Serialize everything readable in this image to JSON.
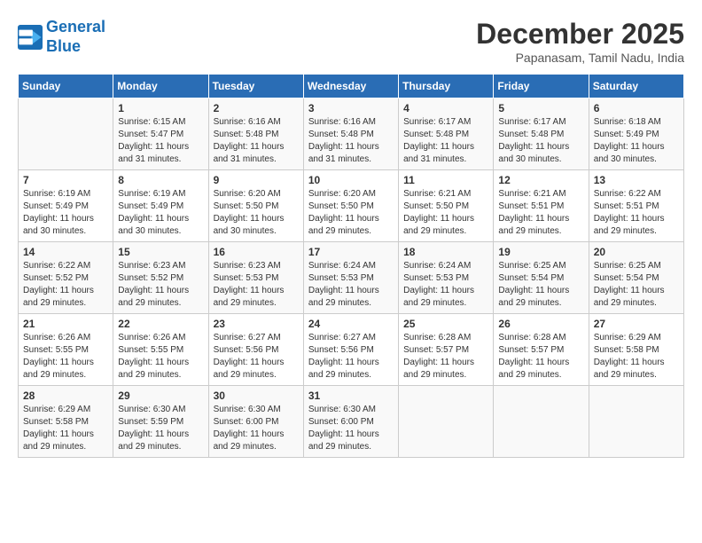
{
  "header": {
    "logo_line1": "General",
    "logo_line2": "Blue",
    "month": "December 2025",
    "location": "Papanasam, Tamil Nadu, India"
  },
  "weekdays": [
    "Sunday",
    "Monday",
    "Tuesday",
    "Wednesday",
    "Thursday",
    "Friday",
    "Saturday"
  ],
  "weeks": [
    [
      {
        "day": "",
        "text": ""
      },
      {
        "day": "1",
        "text": "Sunrise: 6:15 AM\nSunset: 5:47 PM\nDaylight: 11 hours\nand 31 minutes."
      },
      {
        "day": "2",
        "text": "Sunrise: 6:16 AM\nSunset: 5:48 PM\nDaylight: 11 hours\nand 31 minutes."
      },
      {
        "day": "3",
        "text": "Sunrise: 6:16 AM\nSunset: 5:48 PM\nDaylight: 11 hours\nand 31 minutes."
      },
      {
        "day": "4",
        "text": "Sunrise: 6:17 AM\nSunset: 5:48 PM\nDaylight: 11 hours\nand 31 minutes."
      },
      {
        "day": "5",
        "text": "Sunrise: 6:17 AM\nSunset: 5:48 PM\nDaylight: 11 hours\nand 30 minutes."
      },
      {
        "day": "6",
        "text": "Sunrise: 6:18 AM\nSunset: 5:49 PM\nDaylight: 11 hours\nand 30 minutes."
      }
    ],
    [
      {
        "day": "7",
        "text": "Sunrise: 6:19 AM\nSunset: 5:49 PM\nDaylight: 11 hours\nand 30 minutes."
      },
      {
        "day": "8",
        "text": "Sunrise: 6:19 AM\nSunset: 5:49 PM\nDaylight: 11 hours\nand 30 minutes."
      },
      {
        "day": "9",
        "text": "Sunrise: 6:20 AM\nSunset: 5:50 PM\nDaylight: 11 hours\nand 30 minutes."
      },
      {
        "day": "10",
        "text": "Sunrise: 6:20 AM\nSunset: 5:50 PM\nDaylight: 11 hours\nand 29 minutes."
      },
      {
        "day": "11",
        "text": "Sunrise: 6:21 AM\nSunset: 5:50 PM\nDaylight: 11 hours\nand 29 minutes."
      },
      {
        "day": "12",
        "text": "Sunrise: 6:21 AM\nSunset: 5:51 PM\nDaylight: 11 hours\nand 29 minutes."
      },
      {
        "day": "13",
        "text": "Sunrise: 6:22 AM\nSunset: 5:51 PM\nDaylight: 11 hours\nand 29 minutes."
      }
    ],
    [
      {
        "day": "14",
        "text": "Sunrise: 6:22 AM\nSunset: 5:52 PM\nDaylight: 11 hours\nand 29 minutes."
      },
      {
        "day": "15",
        "text": "Sunrise: 6:23 AM\nSunset: 5:52 PM\nDaylight: 11 hours\nand 29 minutes."
      },
      {
        "day": "16",
        "text": "Sunrise: 6:23 AM\nSunset: 5:53 PM\nDaylight: 11 hours\nand 29 minutes."
      },
      {
        "day": "17",
        "text": "Sunrise: 6:24 AM\nSunset: 5:53 PM\nDaylight: 11 hours\nand 29 minutes."
      },
      {
        "day": "18",
        "text": "Sunrise: 6:24 AM\nSunset: 5:53 PM\nDaylight: 11 hours\nand 29 minutes."
      },
      {
        "day": "19",
        "text": "Sunrise: 6:25 AM\nSunset: 5:54 PM\nDaylight: 11 hours\nand 29 minutes."
      },
      {
        "day": "20",
        "text": "Sunrise: 6:25 AM\nSunset: 5:54 PM\nDaylight: 11 hours\nand 29 minutes."
      }
    ],
    [
      {
        "day": "21",
        "text": "Sunrise: 6:26 AM\nSunset: 5:55 PM\nDaylight: 11 hours\nand 29 minutes."
      },
      {
        "day": "22",
        "text": "Sunrise: 6:26 AM\nSunset: 5:55 PM\nDaylight: 11 hours\nand 29 minutes."
      },
      {
        "day": "23",
        "text": "Sunrise: 6:27 AM\nSunset: 5:56 PM\nDaylight: 11 hours\nand 29 minutes."
      },
      {
        "day": "24",
        "text": "Sunrise: 6:27 AM\nSunset: 5:56 PM\nDaylight: 11 hours\nand 29 minutes."
      },
      {
        "day": "25",
        "text": "Sunrise: 6:28 AM\nSunset: 5:57 PM\nDaylight: 11 hours\nand 29 minutes."
      },
      {
        "day": "26",
        "text": "Sunrise: 6:28 AM\nSunset: 5:57 PM\nDaylight: 11 hours\nand 29 minutes."
      },
      {
        "day": "27",
        "text": "Sunrise: 6:29 AM\nSunset: 5:58 PM\nDaylight: 11 hours\nand 29 minutes."
      }
    ],
    [
      {
        "day": "28",
        "text": "Sunrise: 6:29 AM\nSunset: 5:58 PM\nDaylight: 11 hours\nand 29 minutes."
      },
      {
        "day": "29",
        "text": "Sunrise: 6:30 AM\nSunset: 5:59 PM\nDaylight: 11 hours\nand 29 minutes."
      },
      {
        "day": "30",
        "text": "Sunrise: 6:30 AM\nSunset: 6:00 PM\nDaylight: 11 hours\nand 29 minutes."
      },
      {
        "day": "31",
        "text": "Sunrise: 6:30 AM\nSunset: 6:00 PM\nDaylight: 11 hours\nand 29 minutes."
      },
      {
        "day": "",
        "text": ""
      },
      {
        "day": "",
        "text": ""
      },
      {
        "day": "",
        "text": ""
      }
    ]
  ]
}
